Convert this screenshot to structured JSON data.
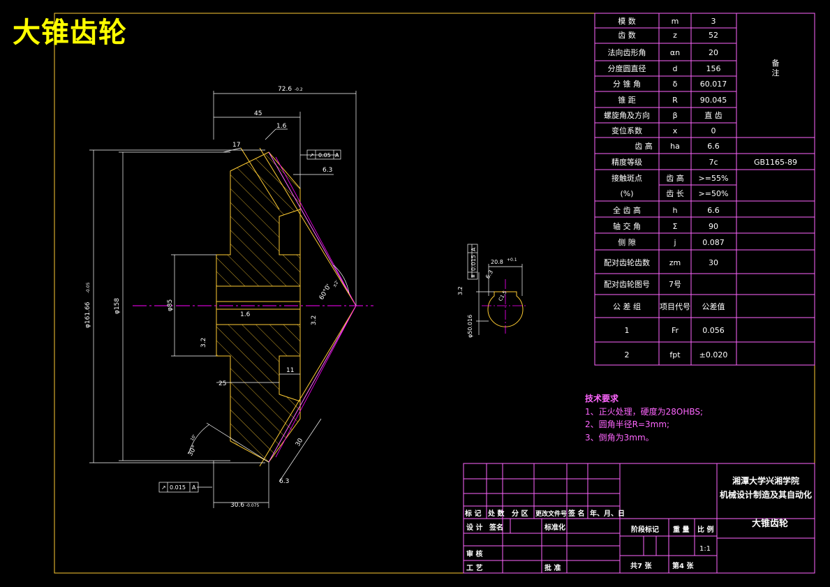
{
  "title": "大锥齿轮",
  "colors": {
    "background": "#000000",
    "frame": "#ffcc33",
    "table_line": "#ff66ff",
    "table_text": "#ffffff",
    "dim_text": "#ffffff",
    "title": "#ffff00",
    "hatch": "#ffcc33",
    "centerline": "#ff00ff"
  },
  "param_table": {
    "rows": [
      {
        "name": "模   数",
        "symbol": "m",
        "value": "3"
      },
      {
        "name": "齿   数",
        "symbol": "z",
        "value": "52"
      },
      {
        "name": "法向齿形角",
        "symbol": "αn",
        "value": "20"
      },
      {
        "name": "分度圆直径",
        "symbol": "d",
        "value": "156"
      },
      {
        "name": "分 锥 角",
        "symbol": "δ",
        "value": "60.017"
      },
      {
        "name": "锥    距",
        "symbol": "R",
        "value": "90.045"
      },
      {
        "name": "螺旋角及方向",
        "symbol": "β",
        "value": "直  齿"
      },
      {
        "name": "变位系数",
        "symbol": "x",
        "value": "0"
      },
      {
        "name": "齿 高",
        "symbol": "ha",
        "value": "6.6"
      },
      {
        "name": "精度等级",
        "symbol": "",
        "value": "7c",
        "note": "GB1165-89"
      },
      {
        "name": "接触斑点",
        "symbol": "齿 高",
        "value": ">=55%"
      },
      {
        "name": "(%)",
        "symbol": "齿 长",
        "value": ">=50%"
      },
      {
        "name": "全 齿 高",
        "symbol": "h",
        "value": "6.6"
      },
      {
        "name": "轴 交 角",
        "symbol": "Σ",
        "value": "90"
      },
      {
        "name": "侧    隙",
        "symbol": "j",
        "value": "0.087"
      },
      {
        "name": "配对齿轮齿数",
        "symbol": "zm",
        "value": "30"
      },
      {
        "name": "配对齿轮图号",
        "symbol": "7号",
        "value": ""
      },
      {
        "name": "公 差 组",
        "symbol": "项目代号",
        "value": "公差值"
      },
      {
        "name": "1",
        "symbol": "Fr",
        "value": "0.056"
      },
      {
        "name": "2",
        "symbol": "fpt",
        "value": "±0.020"
      }
    ],
    "remark": "备\n注"
  },
  "tech_notes": {
    "heading": "技术要求",
    "items": [
      "1、正火处理，硬度为28OHBS;",
      "2、圆角半径R=3mm;",
      "3、倒角为3mm。"
    ]
  },
  "title_block": {
    "school_line1": "湘潭大学兴湘学院",
    "school_line2": "机械设计制造及其自动化",
    "part_name": "大锥齿轮",
    "scale": "1:1",
    "headers": [
      "标 记",
      "处 数",
      "分 区",
      "更改文件号",
      "签 名",
      "年、月、日"
    ],
    "design": "设 计",
    "standardize": "标准化",
    "review": "审 核",
    "process": "工 艺",
    "approve": "批 准",
    "stage_mark": "阶段标记",
    "weight": "重 量",
    "ratio": "比 例",
    "sheets_total": "共7  张",
    "sheet_no": "第4  张",
    "signed_date": "签名"
  },
  "dimensions": {
    "overall_length": "72.6",
    "overall_length_tol": "-0.2",
    "d45": "45",
    "d17": "17",
    "rough16a": "1.6",
    "rough63": "6.3",
    "runout_val": "0.05",
    "runout_ref": "A",
    "dia_outer": "φ161.66",
    "dia_outer_tol": "-0.05",
    "dia158": "φ158",
    "dia_bore": "φ85",
    "rough16b": "1.6",
    "rough32a": "3.2",
    "rough32b": "3.2",
    "angle_cone": "60°0'",
    "angle_tol": "±2'",
    "d25": "25",
    "d11": "11",
    "d30": "30",
    "angle_back": "30°",
    "angle_back_tol": "10'",
    "rough63b": "6.3",
    "runout2_val": "0.015",
    "runout2_ref": "A",
    "d30_6": "30.6",
    "d30_6_tol": "-0.075",
    "keyway_w": "20.8",
    "keyway_tol": "+0.1",
    "sym_val": "0.015",
    "sym_ref": "A",
    "rough_key": "3.2",
    "rough_key2": "6.3",
    "bore_dia": "φ50.016",
    "chamfer": "C1.5"
  }
}
